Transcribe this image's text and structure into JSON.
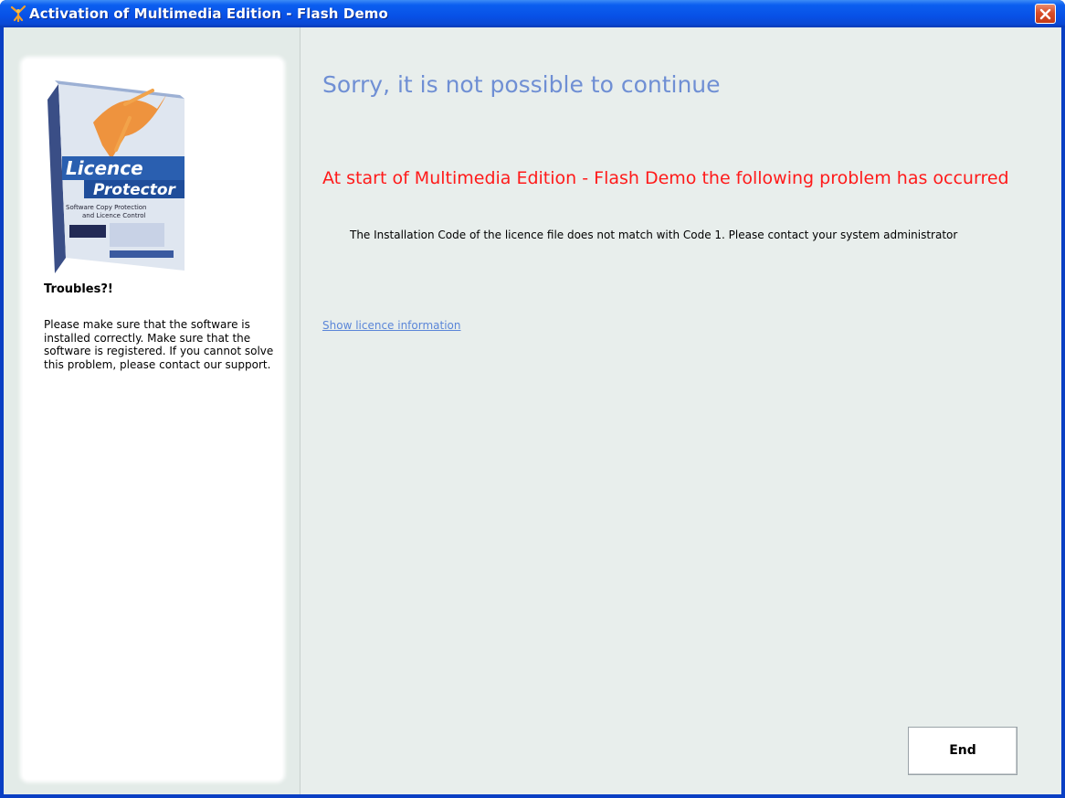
{
  "window": {
    "title": "Activation of Multimedia Edition - Flash Demo",
    "title_icon": "licence-protector-figure-icon",
    "close_icon": "close-icon"
  },
  "sidebar": {
    "product_image": {
      "icon": "licence-protector-box-image",
      "brand_line_1": "Licence",
      "brand_line_2": "Protector",
      "subtitle_1": "Software Copy Protection",
      "subtitle_2": "and Licence Control"
    },
    "heading": "Troubles?!",
    "help_text": "Please make sure that the software is installed correctly. Make sure that the software is registered. If you cannot solve this problem, please contact our support."
  },
  "main": {
    "heading": "Sorry, it is not possible to continue",
    "error_title": "At start of Multimedia Edition - Flash Demo the following problem has occurred",
    "error_detail": "The Installation Code of the licence file does not match with Code 1. Please contact your system administrator",
    "licence_link": "Show licence information",
    "end_button": "End"
  },
  "colors": {
    "titlebar": "#0851e6",
    "heading": "#6f8fd4",
    "error": "#ff1a1a",
    "link": "#5b86d8",
    "background": "#e8eeec"
  }
}
